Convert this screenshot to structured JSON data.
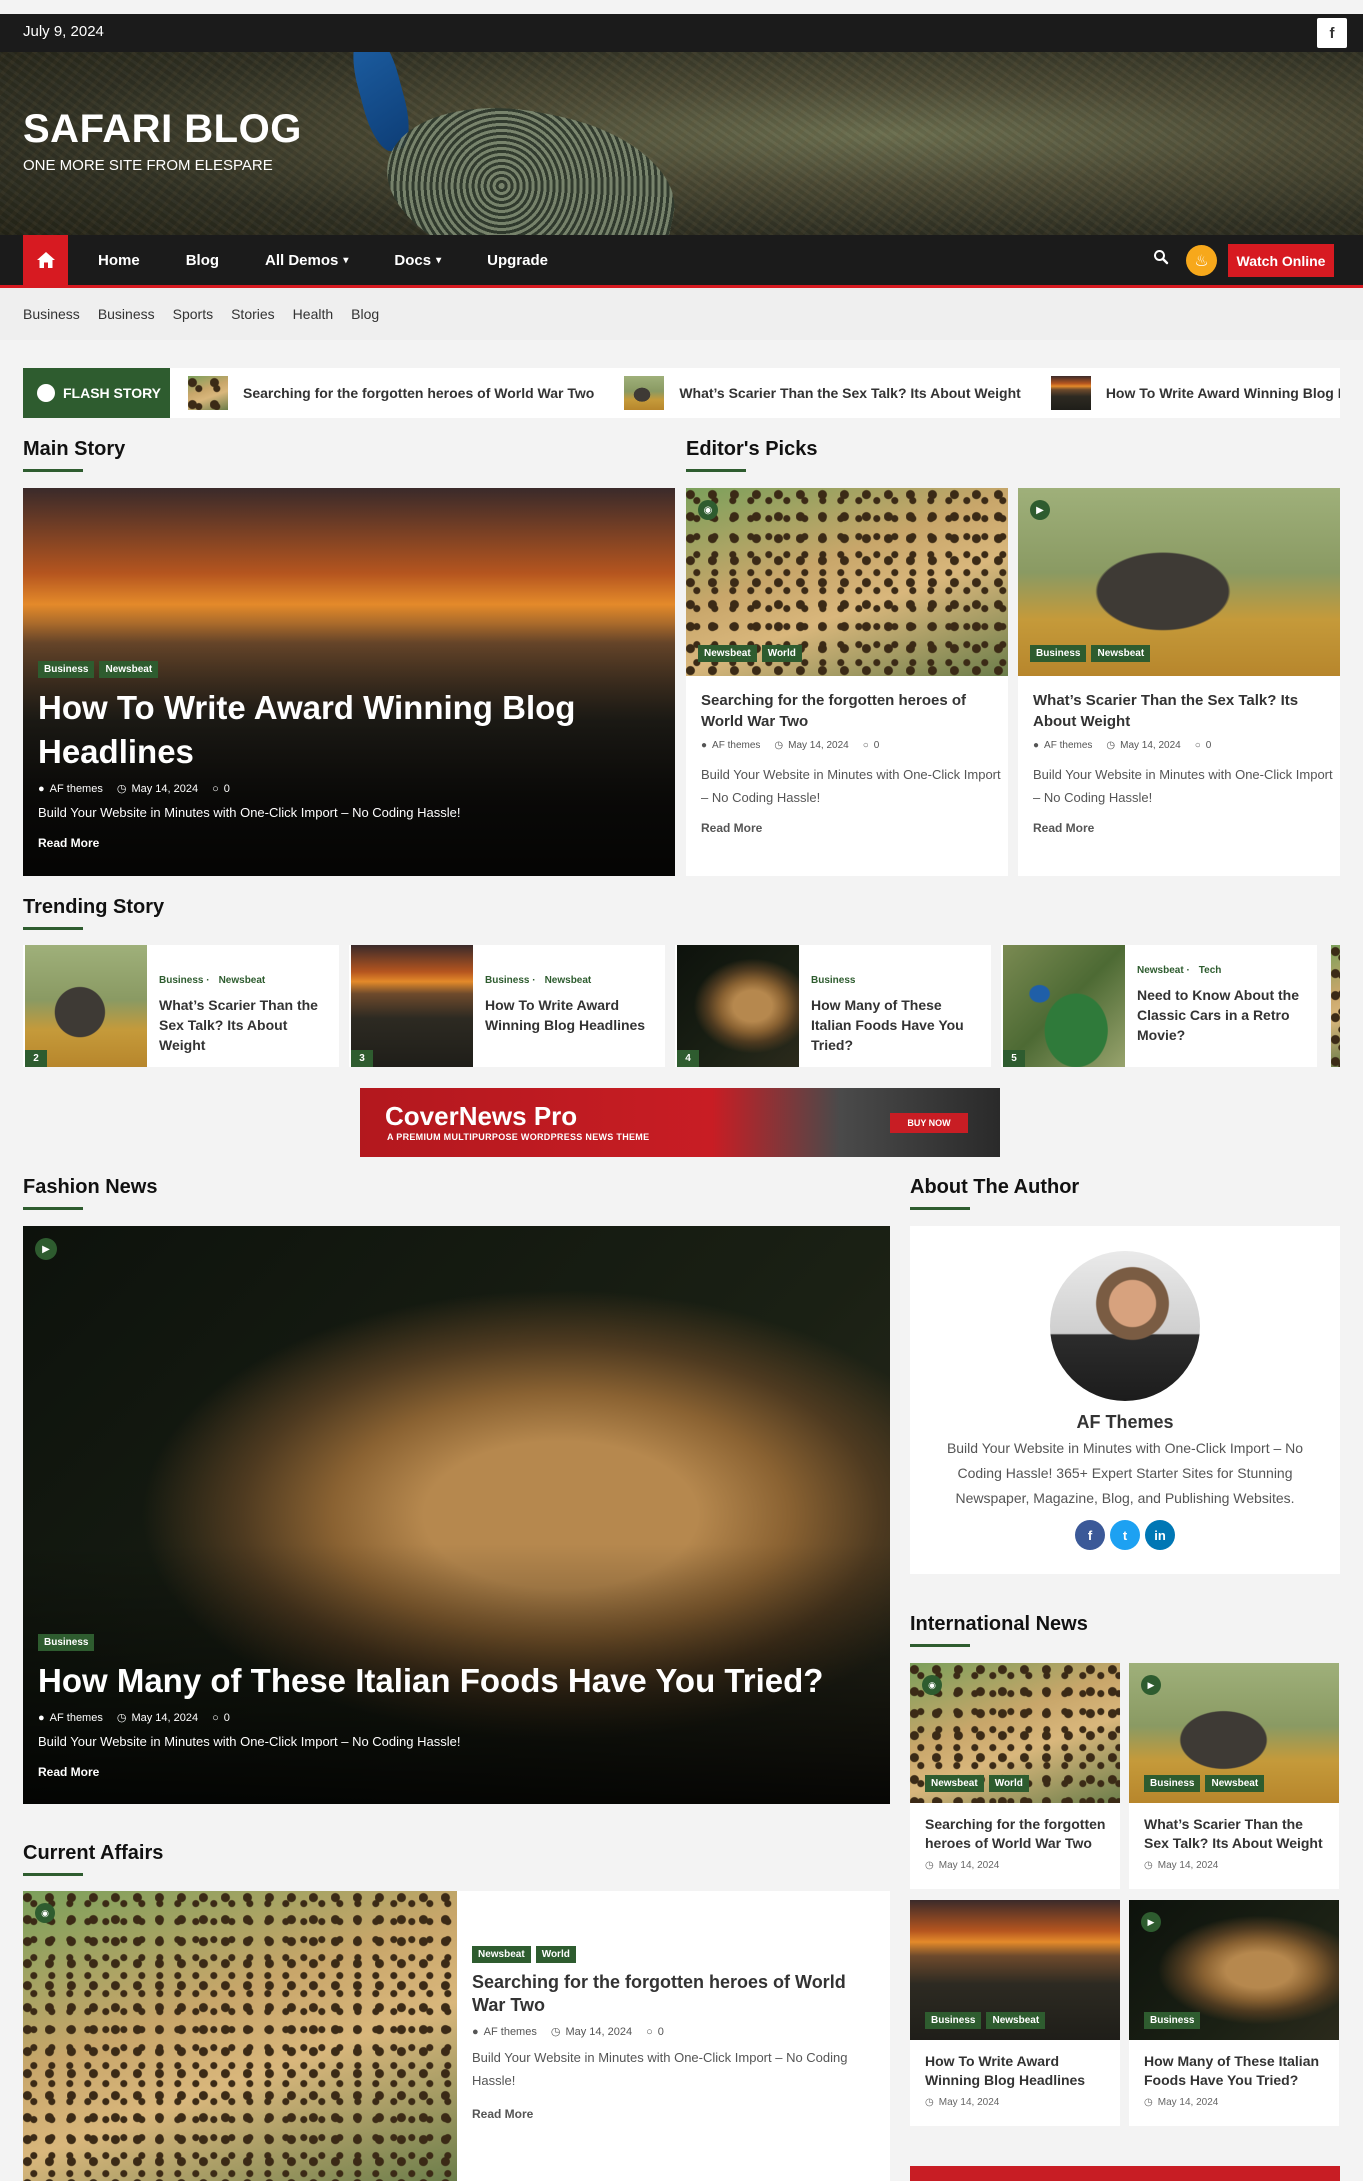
{
  "topbar": {
    "date": "July 9, 2024",
    "facebook_icon": "f"
  },
  "header": {
    "title": "SAFARI BLOG",
    "tagline": "ONE MORE SITE FROM ELESPARE"
  },
  "nav": {
    "items": [
      {
        "label": "Home",
        "dropdown": false
      },
      {
        "label": "Blog",
        "dropdown": false
      },
      {
        "label": "All Demos",
        "dropdown": true
      },
      {
        "label": "Docs",
        "dropdown": true
      },
      {
        "label": "Upgrade",
        "dropdown": false
      }
    ],
    "watch_label": "Watch Online",
    "accent": "#d71a21"
  },
  "subnav": [
    "Business",
    "Business",
    "Sports",
    "Stories",
    "Health",
    "Blog"
  ],
  "flash": {
    "label": "FLASH STORY",
    "items": [
      {
        "title": "Searching for the forgotten heroes of World War Two",
        "thumb": "leopard"
      },
      {
        "title": "What’s Scarier Than the Sex Talk? Its About Weight",
        "thumb": "elephant"
      },
      {
        "title": "How To Write Award Winning Blog Headlines",
        "thumb": "sunset"
      }
    ]
  },
  "sections": {
    "main_story": "Main Story",
    "editors_picks": "Editor's Picks",
    "trending": "Trending Story",
    "fashion": "Fashion News",
    "author": "About The Author",
    "international": "International News",
    "current_affairs": "Current Affairs"
  },
  "main_story": {
    "cats": [
      "Business",
      "Newsbeat"
    ],
    "title": "How To Write Award Winning Blog Headlines",
    "author": "AF themes",
    "date": "May 14, 2024",
    "comments": "0",
    "excerpt": "Build Your Website in Minutes with One-Click Import – No Coding Hassle!",
    "read_more": "Read More"
  },
  "picks": [
    {
      "cats": [
        "Newsbeat",
        "World"
      ],
      "title": "Searching for the forgotten heroes of World War Two",
      "author": "AF themes",
      "date": "May 14, 2024",
      "comments": "0",
      "excerpt": "Build Your Website in Minutes with One-Click Import – No Coding Hassle!",
      "read_more": "Read More",
      "badge_icon": "camera-icon"
    },
    {
      "cats": [
        "Business",
        "Newsbeat"
      ],
      "title": "What’s Scarier Than the Sex Talk? Its About Weight",
      "author": "AF themes",
      "date": "May 14, 2024",
      "comments": "0",
      "excerpt": "Build Your Website in Minutes with One-Click Import – No Coding Hassle!",
      "read_more": "Read More",
      "badge_icon": "video-icon"
    }
  ],
  "trending": [
    {
      "num": "2",
      "cats": [
        "Business ·",
        "Newsbeat"
      ],
      "title": "What’s Scarier Than the Sex Talk? Its About Weight"
    },
    {
      "num": "3",
      "cats": [
        "Business ·",
        "Newsbeat"
      ],
      "title": "How To Write Award Winning Blog Headlines"
    },
    {
      "num": "4",
      "cats": [
        "Business"
      ],
      "title": "How Many of These Italian Foods Have You Tried?"
    },
    {
      "num": "5",
      "cats": [
        "Newsbeat ·",
        "Tech"
      ],
      "title": "Need to Know About the Classic Cars in a Retro Movie?"
    }
  ],
  "ad": {
    "brand": "CoverNews Pro",
    "sub": "A PREMIUM MULTIPURPOSE WORDPRESS NEWS THEME",
    "cta": "BUY NOW"
  },
  "fashion": {
    "cats": [
      "Business"
    ],
    "title": "How Many of These Italian Foods Have You Tried?",
    "author": "AF themes",
    "date": "May 14, 2024",
    "comments": "0",
    "excerpt": "Build Your Website in Minutes with One-Click Import – No Coding Hassle!",
    "read_more": "Read More"
  },
  "author": {
    "name": "AF Themes",
    "bio": "Build Your Website in Minutes with One-Click Import – No Coding Hassle! 365+ Expert Starter Sites for Stunning Newspaper, Magazine, Blog, and Publishing Websites.",
    "social": [
      {
        "icon": "f",
        "color": "#3b5998"
      },
      {
        "icon": "t",
        "color": "#1da1f2"
      },
      {
        "icon": "in",
        "color": "#0077b5"
      }
    ]
  },
  "international": [
    {
      "cats": [
        "Newsbeat",
        "World"
      ],
      "title": "Searching for the forgotten heroes of World War Two",
      "date": "May 14, 2024"
    },
    {
      "cats": [
        "Business",
        "Newsbeat"
      ],
      "title": "What’s Scarier Than the Sex Talk? Its About Weight",
      "date": "May 14, 2024"
    },
    {
      "cats": [
        "Business",
        "Newsbeat"
      ],
      "title": "How To Write Award Winning Blog Headlines",
      "date": "May 14, 2024"
    },
    {
      "cats": [
        "Business"
      ],
      "title": "How Many of These Italian Foods Have You Tried?",
      "date": "May 14, 2024"
    }
  ],
  "current_affairs": {
    "cats": [
      "Newsbeat",
      "World"
    ],
    "title": "Searching for the forgotten heroes of World War Two",
    "author": "AF themes",
    "date": "May 14, 2024",
    "comments": "0",
    "excerpt": "Build Your Website in Minutes with One-Click Import – No Coding Hassle!",
    "read_more": "Read More"
  },
  "colors": {
    "brand_green": "#2e5c2f",
    "accent_red": "#d71a21",
    "dark": "#1b1b1b"
  }
}
